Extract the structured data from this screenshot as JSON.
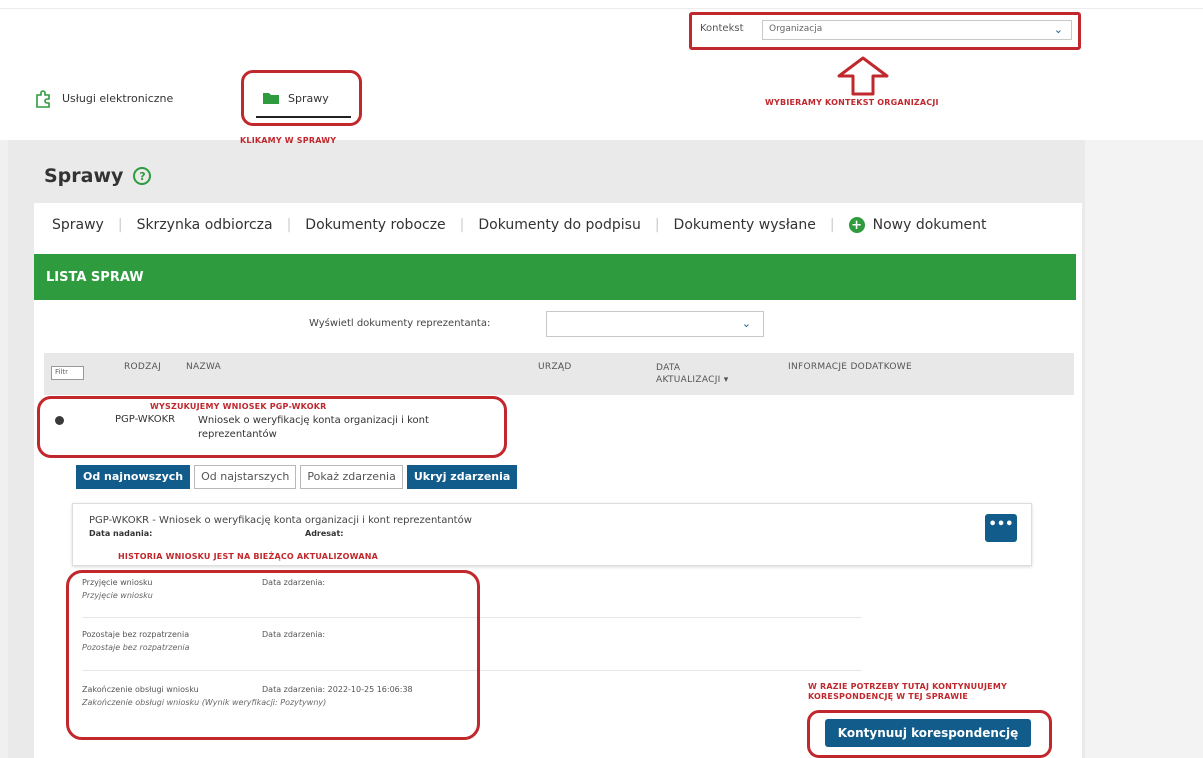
{
  "context": {
    "label": "Kontekst",
    "value": "Organizacja",
    "annotation": "WYBIERAMY KONTEKST ORGANIZACJI"
  },
  "topnav": {
    "items": [
      {
        "label": "Usługi elektroniczne"
      },
      {
        "label": "Sprawy"
      }
    ],
    "annotation": "KLIKAMY W SPRAWY"
  },
  "page": {
    "title": "Sprawy"
  },
  "tabs": [
    {
      "label": "Sprawy"
    },
    {
      "label": "Skrzynka odbiorcza"
    },
    {
      "label": "Dokumenty robocze"
    },
    {
      "label": "Dokumenty do podpisu"
    },
    {
      "label": "Dokumenty wysłane"
    },
    {
      "label": "Nowy dokument"
    }
  ],
  "list": {
    "header": "LISTA SPRAW",
    "filter_label": "Wyświetl dokumenty reprezentanta:",
    "filter_value": "",
    "mini_filter": "Filtr",
    "columns": {
      "rodzaj": "RODZAJ",
      "nazwa": "NAZWA",
      "urzad": "URZĄD",
      "data": "DATA AKTUALIZACJI",
      "info": "INFORMACJE DODATKOWE"
    },
    "row": {
      "code": "PGP-WKOKR",
      "name": "Wniosek o weryfikację konta organizacji i kont reprezentantów",
      "annotation": "WYSZUKUJEMY WNIOSEK PGP-WKOKR"
    }
  },
  "event_buttons": [
    {
      "label": "Od najnowszych",
      "active": true
    },
    {
      "label": "Od najstarszych",
      "active": false
    },
    {
      "label": "Pokaż zdarzenia",
      "active": false
    },
    {
      "label": "Ukryj zdarzenia",
      "active": true
    }
  ],
  "document": {
    "title": "PGP-WKOKR - Wniosek o weryfikację konta organizacji i kont reprezentantów",
    "date_label": "Data nadania:",
    "recipient_label": "Adresat:",
    "more": "•••",
    "annotation": "HISTORIA WNIOSKU JEST NA BIEŻĄCO AKTUALIZOWANA"
  },
  "events": [
    {
      "name": "Przyjęcie wniosku",
      "date_label": "Data zdarzenia:",
      "desc": "Przyjęcie wniosku"
    },
    {
      "name": "Pozostaje bez rozpatrzenia",
      "date_label": "Data zdarzenia:",
      "desc": "Pozostaje bez rozpatrzenia"
    },
    {
      "name": "Zakończenie obsługi wniosku",
      "date_label": "Data zdarzenia: 2022-10-25 16:06:38",
      "desc": "Zakończenie obsługi wniosku (Wynik weryfikacji: Pozytywny)"
    }
  ],
  "continue": {
    "annotation": "W RAZIE POTRZEBY TUTAJ KONTYNUUJEMY KORESPONDENCJĘ W TEJ SPRAWIE",
    "button": "Kontynuuj korespondencję"
  },
  "colors": {
    "green": "#2e9b3e",
    "blue": "#115c8a",
    "annotation_red": "#c0282d"
  }
}
